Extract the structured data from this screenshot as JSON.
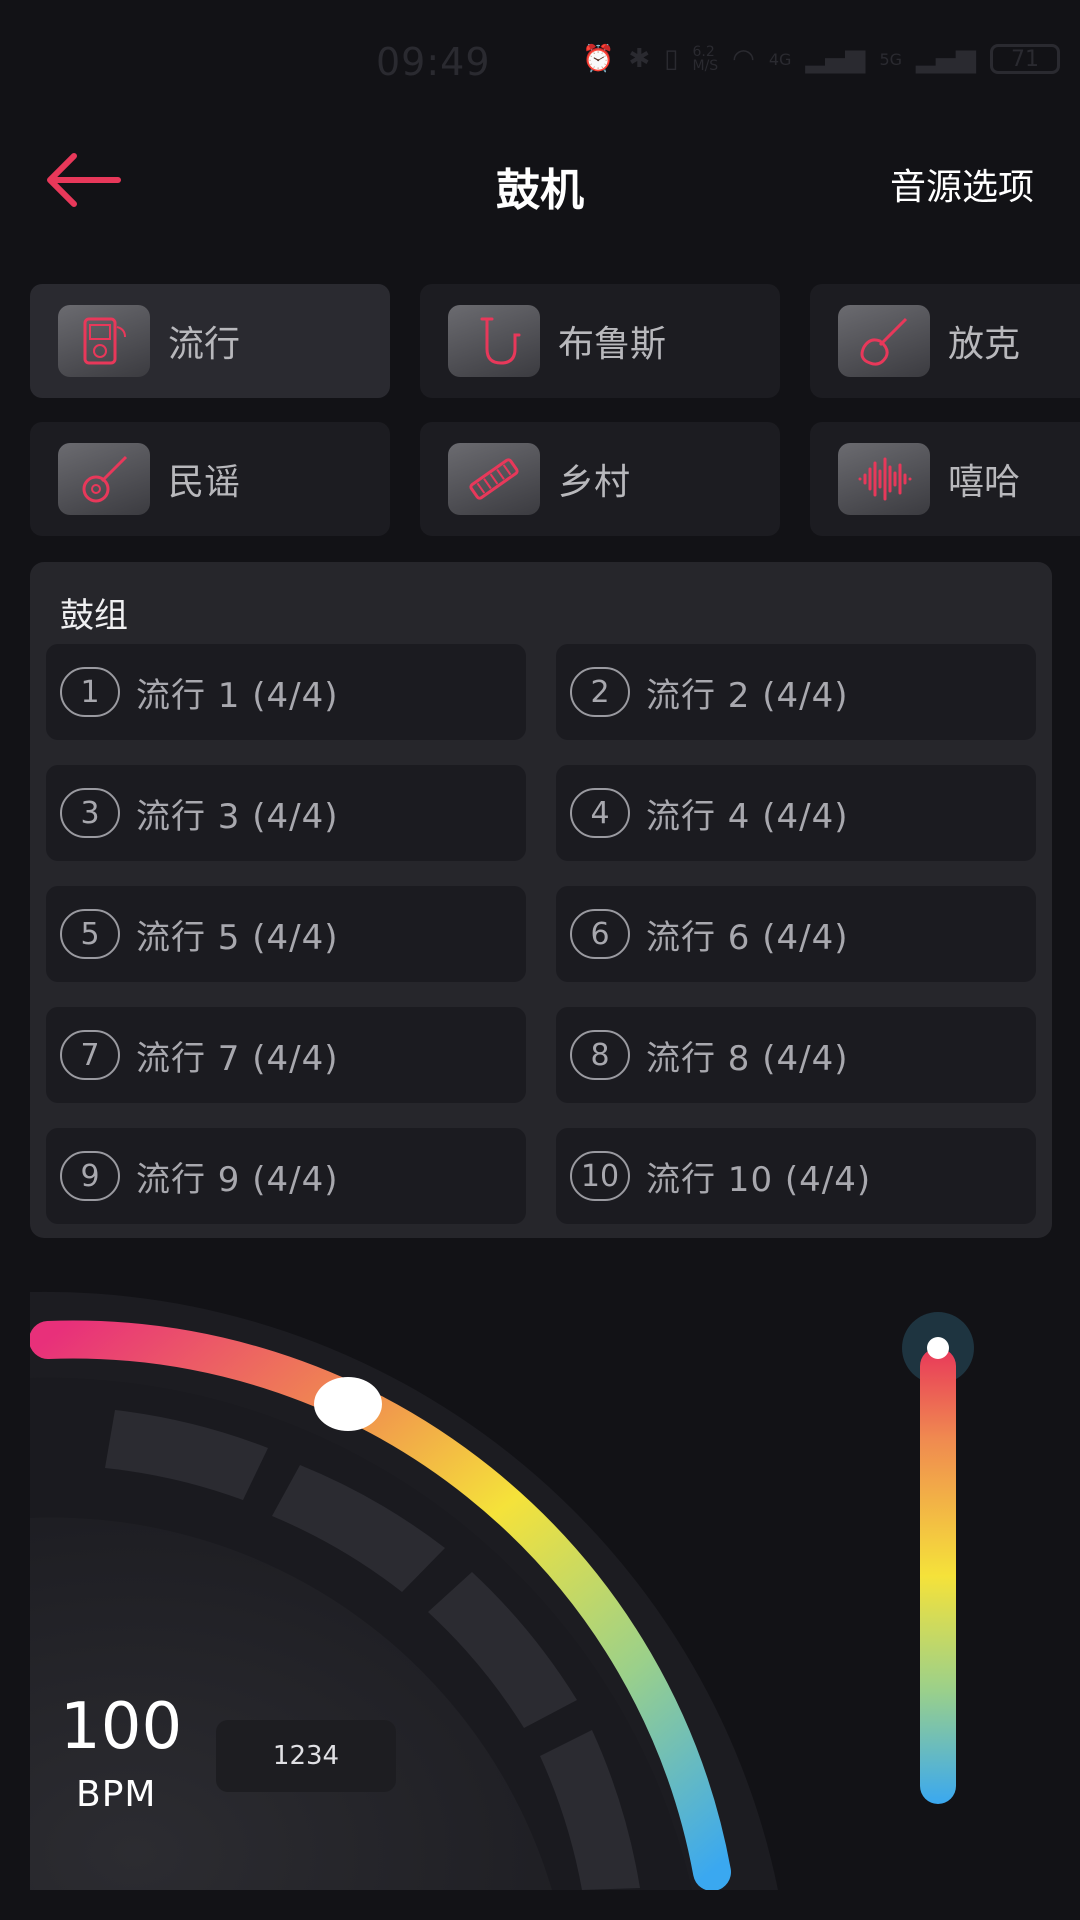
{
  "status": {
    "time": "09:49",
    "speed": "6.2\nM/S",
    "net1": "4G",
    "net2": "5G",
    "battery": "71"
  },
  "header": {
    "title": "鼓机",
    "source_label": "音源选项"
  },
  "genres": [
    {
      "label": "流行",
      "icon": "music-player-icon",
      "active": true
    },
    {
      "label": "布鲁斯",
      "icon": "saxophone-icon",
      "active": false
    },
    {
      "label": "放克",
      "icon": "electric-guitar-icon",
      "active": false
    },
    {
      "label": "民谣",
      "icon": "acoustic-guitar-icon",
      "active": false
    },
    {
      "label": "乡村",
      "icon": "harmonica-icon",
      "active": false
    },
    {
      "label": "嘻哈",
      "icon": "sound-wave-icon",
      "active": false
    }
  ],
  "kit": {
    "title": "鼓组",
    "items": [
      {
        "num": "1",
        "label": "流行 1 (4/4)"
      },
      {
        "num": "2",
        "label": "流行 2 (4/4)"
      },
      {
        "num": "3",
        "label": "流行 3 (4/4)"
      },
      {
        "num": "4",
        "label": "流行 4 (4/4)"
      },
      {
        "num": "5",
        "label": "流行 5 (4/4)"
      },
      {
        "num": "6",
        "label": "流行 6 (4/4)"
      },
      {
        "num": "7",
        "label": "流行 7 (4/4)"
      },
      {
        "num": "8",
        "label": "流行 8 (4/4)"
      },
      {
        "num": "9",
        "label": "流行 9 (4/4)"
      },
      {
        "num": "10",
        "label": "流行 10 (4/4)"
      }
    ]
  },
  "tempo": {
    "bpm": "100",
    "unit": "BPM",
    "beats": "1234",
    "dial_position": 0.25,
    "volume_level": 1.0
  },
  "colors": {
    "accent": "#e8385a",
    "background": "#121216",
    "panel": "#26262b"
  }
}
